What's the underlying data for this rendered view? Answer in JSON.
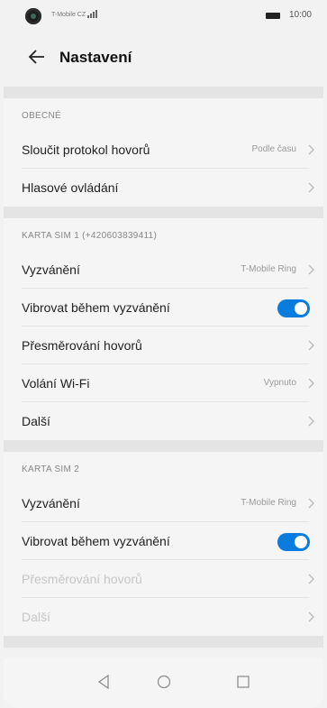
{
  "status": {
    "carrier": "T-Mobile CZ",
    "time": "10:00"
  },
  "header": {
    "title": "Nastavení",
    "back_icon": "back-arrow-icon"
  },
  "general": {
    "header": "OBECNÉ",
    "rows": [
      {
        "label": "Sloučit protokol hovorů",
        "value": "Podle času"
      },
      {
        "label": "Hlasové ovládání"
      }
    ]
  },
  "sim1": {
    "header": "KARTA SIM 1 (+420603839411)",
    "rows": [
      {
        "label": "Vyzvánění",
        "value": "T-Mobile Ring"
      },
      {
        "label": "Vibrovat během vyzvánění",
        "toggle": true
      },
      {
        "label": "Přesměrování hovorů"
      },
      {
        "label": "Volání Wi-Fi",
        "value": "Vypnuto"
      },
      {
        "label": "Další"
      }
    ]
  },
  "sim2": {
    "header": "KARTA SIM 2",
    "rows": [
      {
        "label": "Vyzvánění",
        "value": "T-Mobile Ring"
      },
      {
        "label": "Vibrovat během vyzvánění",
        "toggle": true
      },
      {
        "label": "Přesměrování hovorů",
        "disabled": true
      },
      {
        "label": "Další",
        "disabled": true
      }
    ]
  },
  "colors": {
    "accent": "#0a7cde",
    "background": "#f5f5f5",
    "separator": "#e4e4e4"
  }
}
